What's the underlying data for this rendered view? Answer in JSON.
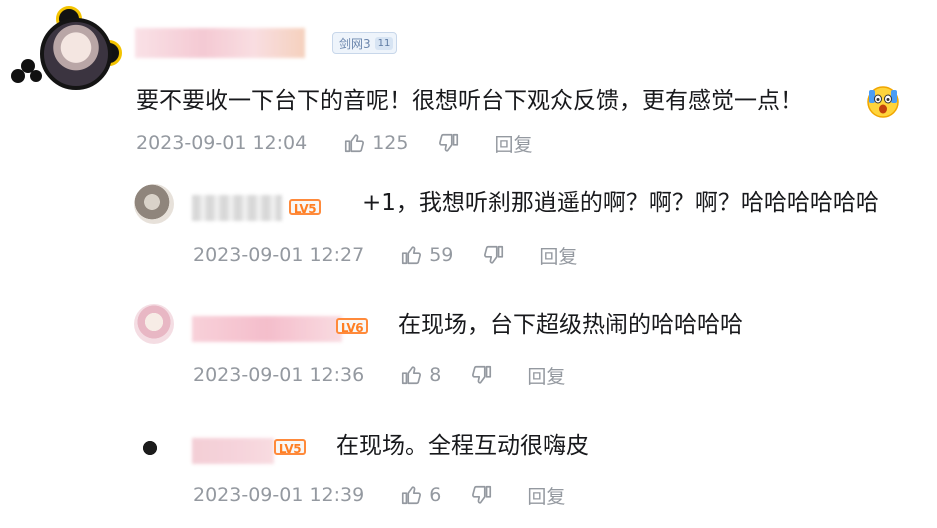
{
  "main_comment": {
    "medal_label": "剑网3",
    "medal_level": "11",
    "text": "要不要收一下台下的音呢！很想听台下观众反馈，更有感觉一点！",
    "emoji_icon": "shocked-face-emoji",
    "time": "2023-09-01 12:04",
    "likes": "125",
    "reply_label": "回复"
  },
  "replies": [
    {
      "level_badge": "LV5",
      "text": "+1，我想听刹那逍遥的啊？啊？啊？哈哈哈哈哈哈",
      "time": "2023-09-01 12:27",
      "likes": "59",
      "reply_label": "回复"
    },
    {
      "level_badge": "LV6",
      "text": "在现场，台下超级热闹的哈哈哈哈",
      "time": "2023-09-01 12:36",
      "likes": "8",
      "reply_label": "回复"
    },
    {
      "level_badge": "LV5",
      "text": "在现场。全程互动很嗨皮",
      "time": "2023-09-01 12:39",
      "likes": "6",
      "reply_label": "回复"
    }
  ],
  "icons": {
    "like": "thumbs-up-icon",
    "dislike": "thumbs-down-icon"
  },
  "colors": {
    "text": "#18191c",
    "meta": "#9499a0",
    "level_badge": "#ff7f24",
    "medal_bg": "#eef4fb",
    "medal_text": "#6b86ad"
  }
}
